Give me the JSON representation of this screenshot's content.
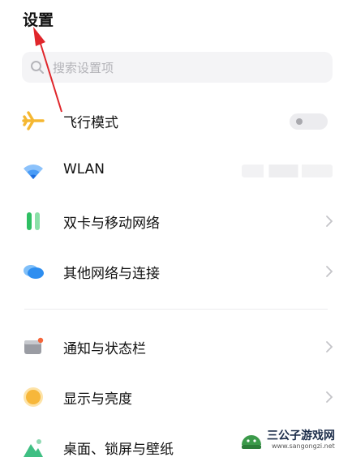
{
  "header": {
    "title": "设置"
  },
  "search": {
    "placeholder": "搜索设置项"
  },
  "items": [
    {
      "label": "飞行模式",
      "icon": "airplane-icon",
      "control": "toggle",
      "toggle_on": false
    },
    {
      "label": "WLAN",
      "icon": "wifi-icon",
      "control": "value-obscured"
    },
    {
      "label": "双卡与移动网络",
      "icon": "dual-sim-icon",
      "control": "chevron"
    },
    {
      "label": "其他网络与连接",
      "icon": "cloud-network-icon",
      "control": "chevron"
    },
    {
      "label": "通知与状态栏",
      "icon": "notification-icon",
      "control": "chevron"
    },
    {
      "label": "显示与亮度",
      "icon": "brightness-icon",
      "control": "chevron"
    },
    {
      "label": "桌面、锁屏与壁纸",
      "icon": "wallpaper-icon",
      "control": "chevron"
    }
  ],
  "watermark": {
    "name": "三公子游戏网",
    "url": "www.sangongzi.net"
  },
  "colors": {
    "annotation_arrow": "#e0262b",
    "airplane": "#f5b731",
    "wifi": "#2f8af5",
    "dual_sim": "#3ec46d",
    "cloud": "#3b9bf3",
    "brightness": "#f7b73a"
  }
}
